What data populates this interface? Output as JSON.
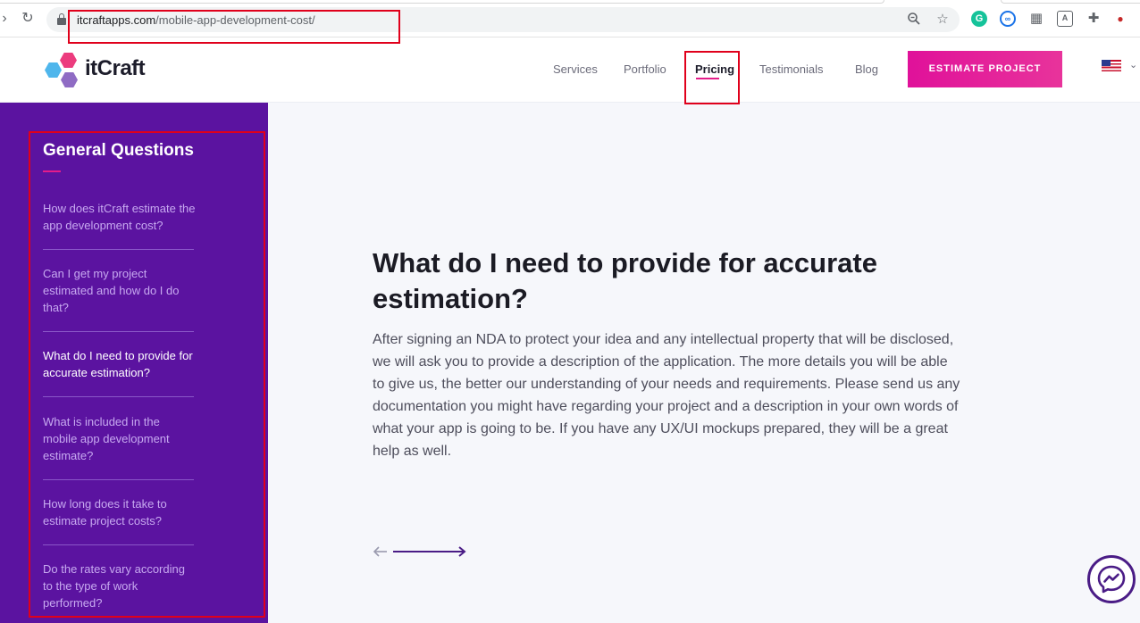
{
  "browser": {
    "url_domain": "itcraftapps.com",
    "url_path": "/mobile-app-development-cost/"
  },
  "header": {
    "logo_text": "itCraft",
    "nav": [
      "Services",
      "Portfolio",
      "Pricing",
      "Testimonials",
      "Blog"
    ],
    "active_nav": "Pricing",
    "cta_label": "ESTIMATE PROJECT"
  },
  "sidebar": {
    "title": "General Questions",
    "items": [
      "How does itCraft estimate the app development cost?",
      "Can I get my project estimated and how do I do that?",
      "What do I need to provide for accurate estimation?",
      "What is included in the mobile app development estimate?",
      "How long does it take to estimate project costs?",
      "Do the rates vary according to the type of work performed?"
    ],
    "active_index": 2
  },
  "main": {
    "title": "What do I need to provide for accurate estimation?",
    "body": "After signing an NDA to protect your idea and any intellectual property that will be disclosed, we will ask you to provide a description of the application. The more details you will be able to give us, the better our understanding of your needs and requirements. Please send us any documentation you might have regarding your project and a description in your own words of what your app is going to be. If you have any UX/UI mockups prepared, they will be a great help as well."
  },
  "colors": {
    "sidebar_bg": "#5b13a0",
    "accent_pink": "#e41d8a",
    "highlight_box": "#e0001b"
  }
}
